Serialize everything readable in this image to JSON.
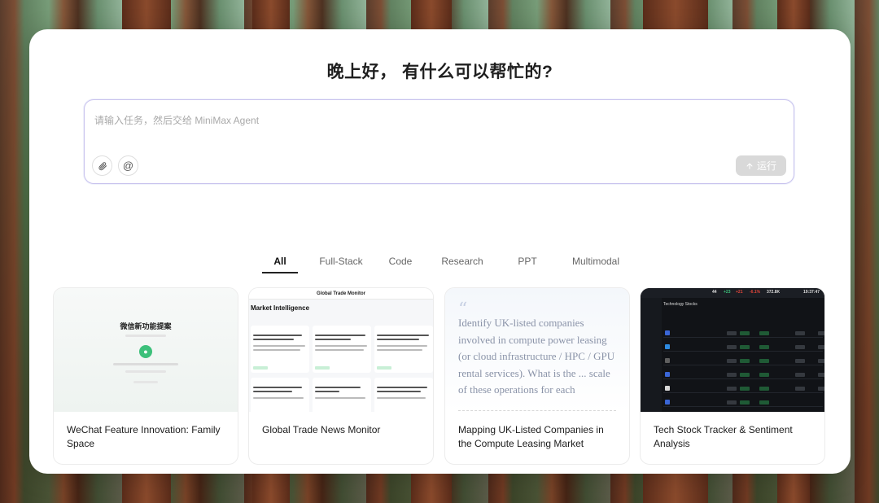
{
  "header": {
    "greeting": "晚上好， 有什么可以帮忙的?"
  },
  "prompt": {
    "placeholder": "请输入任务，然后交给 MiniMax Agent",
    "value": "",
    "attach_icon": "paperclip-icon",
    "mention_icon": "at-icon",
    "mention_glyph": "@",
    "run_label": "运行",
    "run_icon": "arrow-up-icon"
  },
  "tabs": [
    {
      "label": "All",
      "active": true
    },
    {
      "label": "Full-Stack",
      "active": false
    },
    {
      "label": "Code",
      "active": false
    },
    {
      "label": "Research",
      "active": false
    },
    {
      "label": "PPT",
      "active": false
    },
    {
      "label": "Multimodal",
      "active": false
    }
  ],
  "cards": [
    {
      "title": "WeChat Feature Innovation: Family Space",
      "preview": {
        "heading": "微信新功能提案"
      }
    },
    {
      "title": "Global Trade News Monitor",
      "preview": {
        "header": "Global Trade Monitor",
        "heading": "Market Intelligence"
      }
    },
    {
      "title": "Mapping UK-Listed Companies in the Compute Leasing Market",
      "preview": {
        "quote": "Identify UK-listed companies involved in compute power leasing (or cloud infrastructure / HPC / GPU rental services). What is the ... scale of these operations for each"
      }
    },
    {
      "title": "Tech Stock Tracker & Sentiment Analysis",
      "preview": {
        "heading": "Technology Stocks",
        "stat_values": [
          "44",
          "+23",
          "+21",
          "-6.1%",
          "372.8K",
          "19:37:47"
        ]
      }
    }
  ],
  "colors": {
    "accent_border": "#c9c3ee",
    "run_button_bg": "#d9d9d9",
    "positive": "#3cc07a",
    "negative": "#e0453a"
  }
}
